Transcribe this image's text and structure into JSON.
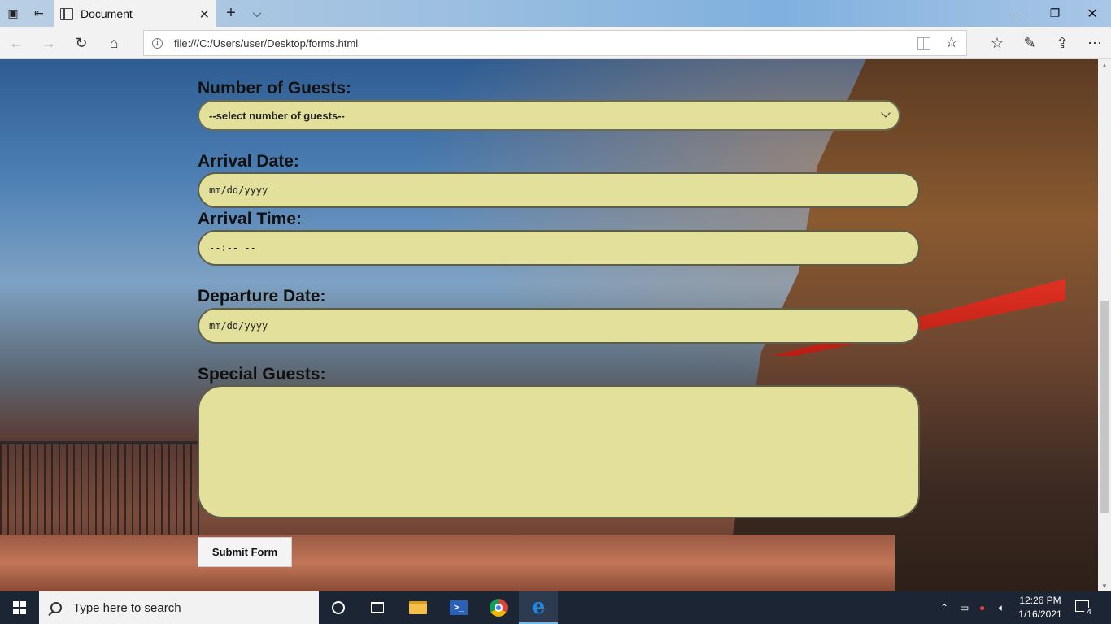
{
  "browser": {
    "tab_title": "Document",
    "tab_close": "✕",
    "new_tab": "+",
    "tab_menu": "⌵",
    "address_url": "file:///C:/Users/user/Desktop/forms.html",
    "nav": {
      "back": "←",
      "forward": "→",
      "refresh": "↻",
      "home": "⌂"
    },
    "toolbar_icons": {
      "favorites": "☆",
      "reading_list": "✎",
      "share": "⇪",
      "more": "⋯"
    },
    "window": {
      "minimize": "—",
      "restore": "❐",
      "close": "✕"
    }
  },
  "form": {
    "guests_label": "Number of Guests:",
    "guests_select_value": "--select number of guests--",
    "arrival_date_label": "Arrival Date:",
    "arrival_date_value": "mm/dd/yyyy",
    "arrival_time_label": "Arrival Time:",
    "arrival_time_value": "--:-- --",
    "departure_date_label": "Departure Date:",
    "departure_date_value": "mm/dd/yyyy",
    "special_guests_label": "Special Guests:",
    "special_guests_value": "",
    "submit_label": "Submit Form",
    "field_color": "#e3e09b"
  },
  "taskbar": {
    "search_placeholder": "Type here to search",
    "clock_time": "12:26 PM",
    "clock_date": "1/16/2021",
    "notification_count": "4",
    "apps": [
      "cortana-icon",
      "task-view-icon",
      "file-explorer-icon",
      "powershell-icon",
      "chrome-icon",
      "edge-icon"
    ],
    "ps_glyph": ">_",
    "edge_glyph": "e"
  }
}
